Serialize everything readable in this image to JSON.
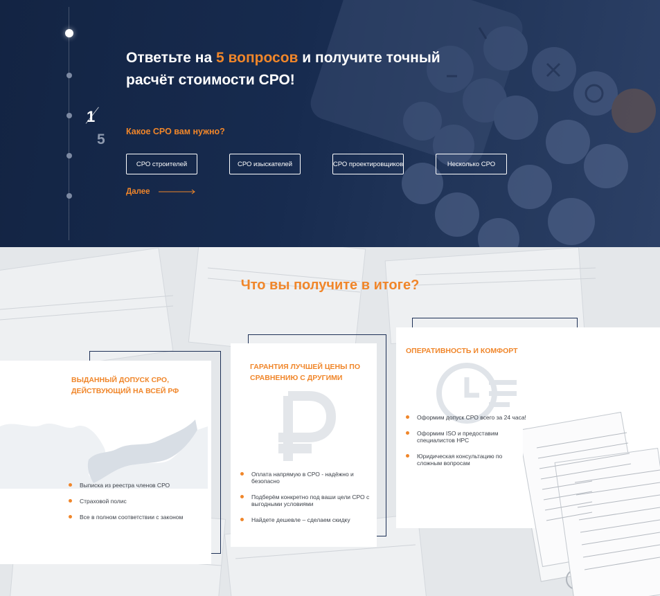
{
  "quiz": {
    "title_part1": "Ответьте на ",
    "title_accent": "5 вопросов",
    "title_part2": " и получите точный расчёт стоимости СРО!",
    "counter_current": "1",
    "counter_total": "5",
    "question": "Какое СРО вам нужно?",
    "options": [
      "СРО строителей",
      "СРО изыскателей",
      "СРО проектировщиков",
      "Несколько СРО"
    ],
    "next_label": "Далее"
  },
  "results": {
    "title": "Что вы получите в итоге?",
    "cards": [
      {
        "title": "Выданный допуск СРО, действующий на всей РФ",
        "items": [
          "Выписка из реестра членов СРО",
          "Страховой полис",
          "Все в полном соответствии с законом"
        ]
      },
      {
        "title": "Гарантия лучшей цены по сравнению с другими",
        "items": [
          "Оплата напрямую в СРО - надёжно и безопасно",
          "Подберём конкретно под ваши цели СРО с выгодными условиями",
          "Найдете дешевле – сделаем скидку"
        ]
      },
      {
        "title": "Оперативность и комфорт",
        "items": [
          "Оформим допуск СРО всего за 24 часа!",
          "Оформим ISO и предоставим специалистов НРС",
          "Юридическая консультацию по сложным вопросам"
        ]
      }
    ]
  },
  "colors": {
    "accent": "#f0862a",
    "navy": "#172b4f"
  },
  "icons": [
    "russia-map-icon",
    "ruble-icon",
    "clock-icon",
    "calculator-background"
  ]
}
